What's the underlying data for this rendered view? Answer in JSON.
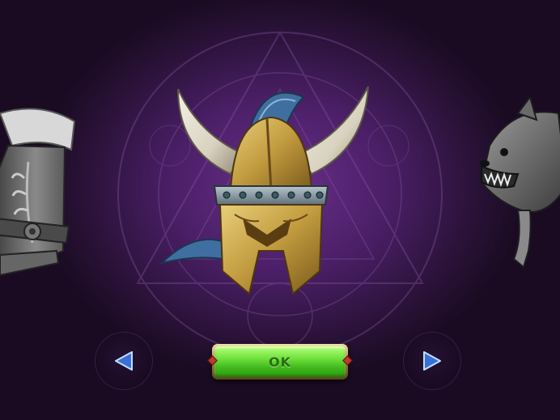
{
  "screen": {
    "name": "item-showcase",
    "background_color": "#4a1f66"
  },
  "items": {
    "left": {
      "icon": "fur-boot-icon",
      "state": "locked"
    },
    "center": {
      "icon": "horned-helmet-icon",
      "state": "selected"
    },
    "right": {
      "icon": "wolf-head-icon",
      "state": "locked"
    }
  },
  "nav": {
    "prev_icon": "left-arrow-icon",
    "next_icon": "right-arrow-icon",
    "arrow_color": "#3a6fd8"
  },
  "ok_button": {
    "label": "OK",
    "color": "#5ed42c"
  }
}
